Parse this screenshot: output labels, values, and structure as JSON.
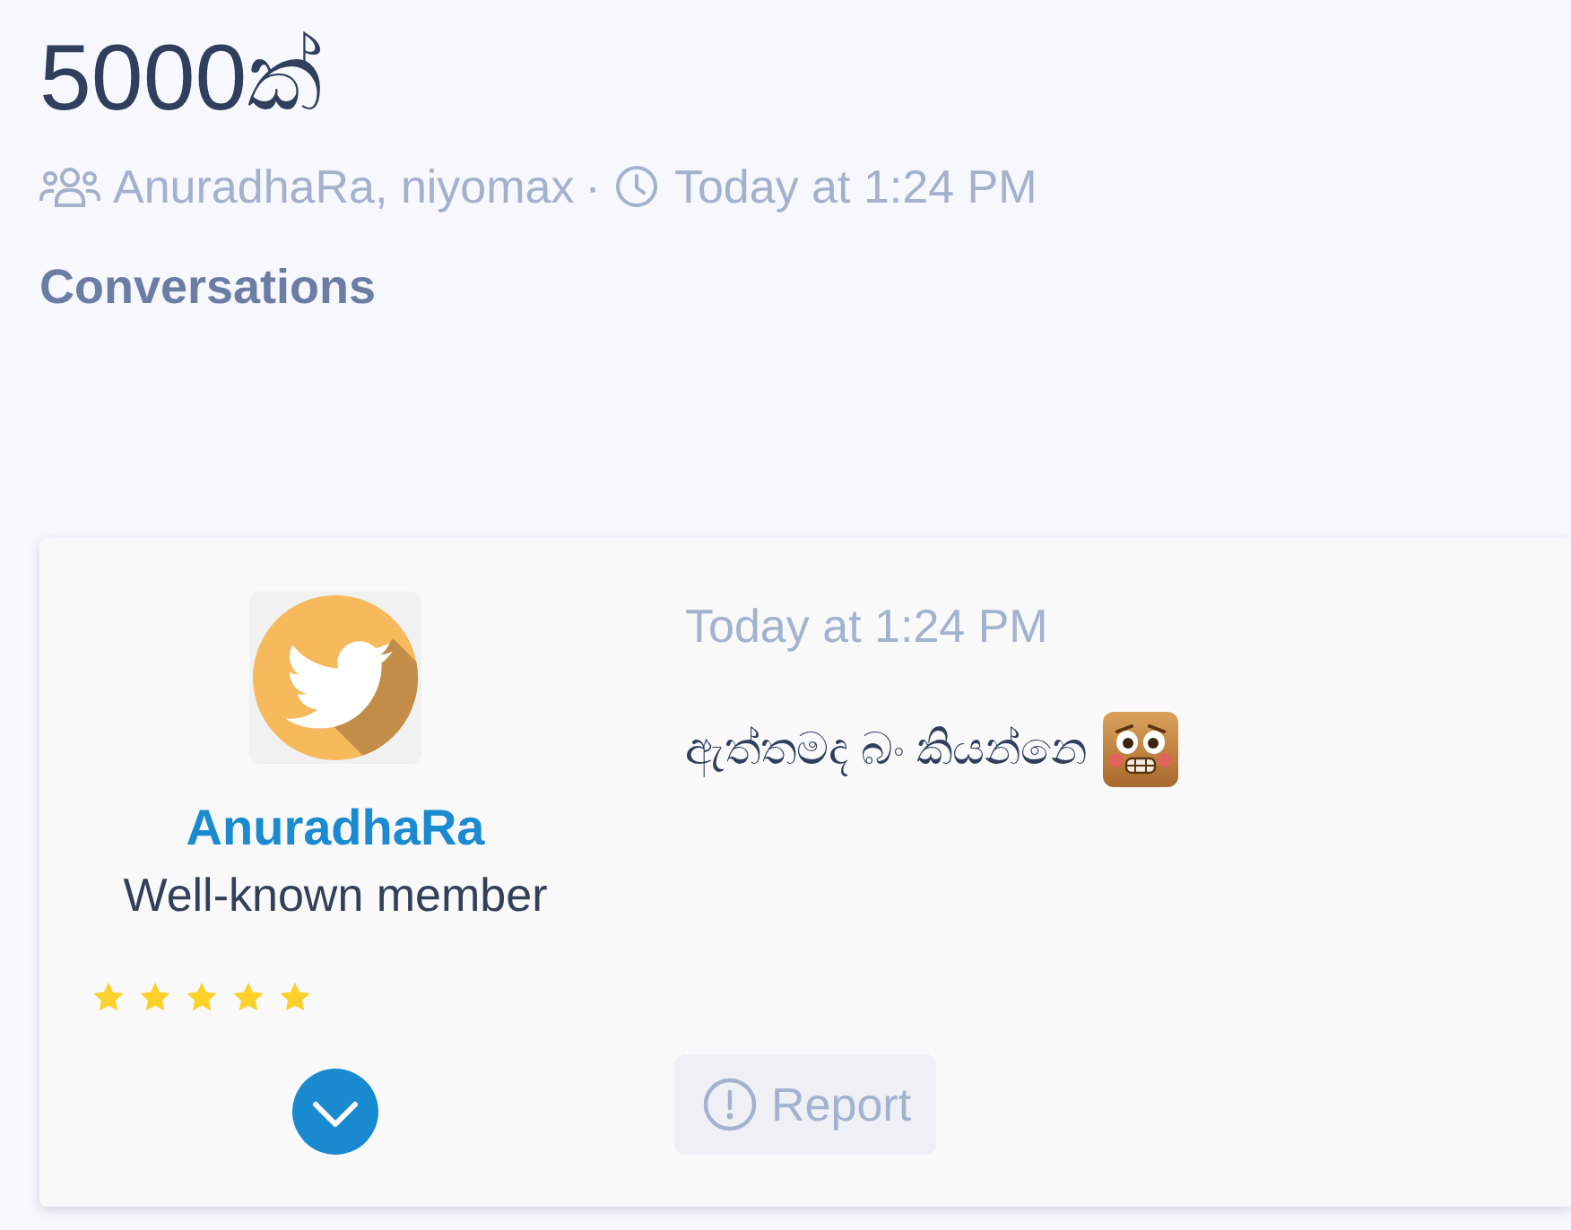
{
  "thread": {
    "title": "5000ක්",
    "participants": "AnuradhaRa, niyomax",
    "separator": "·",
    "started": "Today at 1:24 PM"
  },
  "section_heading": "Conversations",
  "messages": [
    {
      "author": {
        "name": "AnuradhaRa",
        "title": "Well-known member",
        "stars": 5
      },
      "time": "Today at 1:24 PM",
      "body": "ඇත්තමද බං කියන්නෙ",
      "actions": [
        {
          "kind": "report",
          "label": "Report"
        }
      ]
    }
  ]
}
